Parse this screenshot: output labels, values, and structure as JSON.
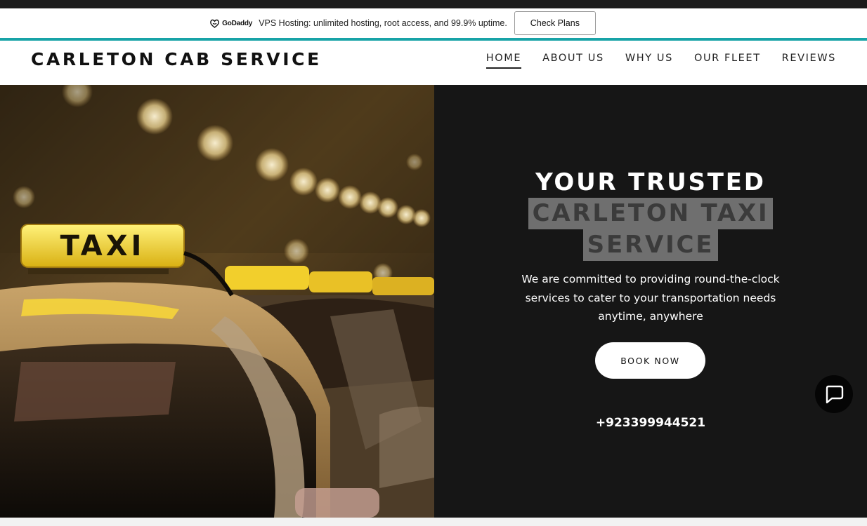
{
  "promo": {
    "brand": "GoDaddy",
    "text": "VPS Hosting: unlimited hosting, root access, and 99.9% uptime.",
    "cta": "Check Plans"
  },
  "header": {
    "site_title": "CARLETON CAB SERVICE",
    "nav": [
      "HOME",
      "ABOUT US",
      "WHY US",
      "OUR FLEET",
      "REVIEWS"
    ],
    "active": "HOME"
  },
  "hero": {
    "image_sign_text": "TAXI",
    "headline_line1": "YOUR TRUSTED",
    "headline_line2": "CARLETON TAXI",
    "headline_line3": "SERVICE",
    "subtext": "We are committed to providing round-the-clock services to cater to your transportation needs anytime, anywhere",
    "cta": "BOOK NOW",
    "phone": "+923399944521"
  },
  "colors": {
    "accent": "#18a3a7",
    "hero_bg": "#161616",
    "taxi_sign": "#f3dc34",
    "selection": "#6f6f6f"
  },
  "icons": {
    "brand": "godaddy-logo-icon",
    "chat": "chat-bubble-icon"
  }
}
